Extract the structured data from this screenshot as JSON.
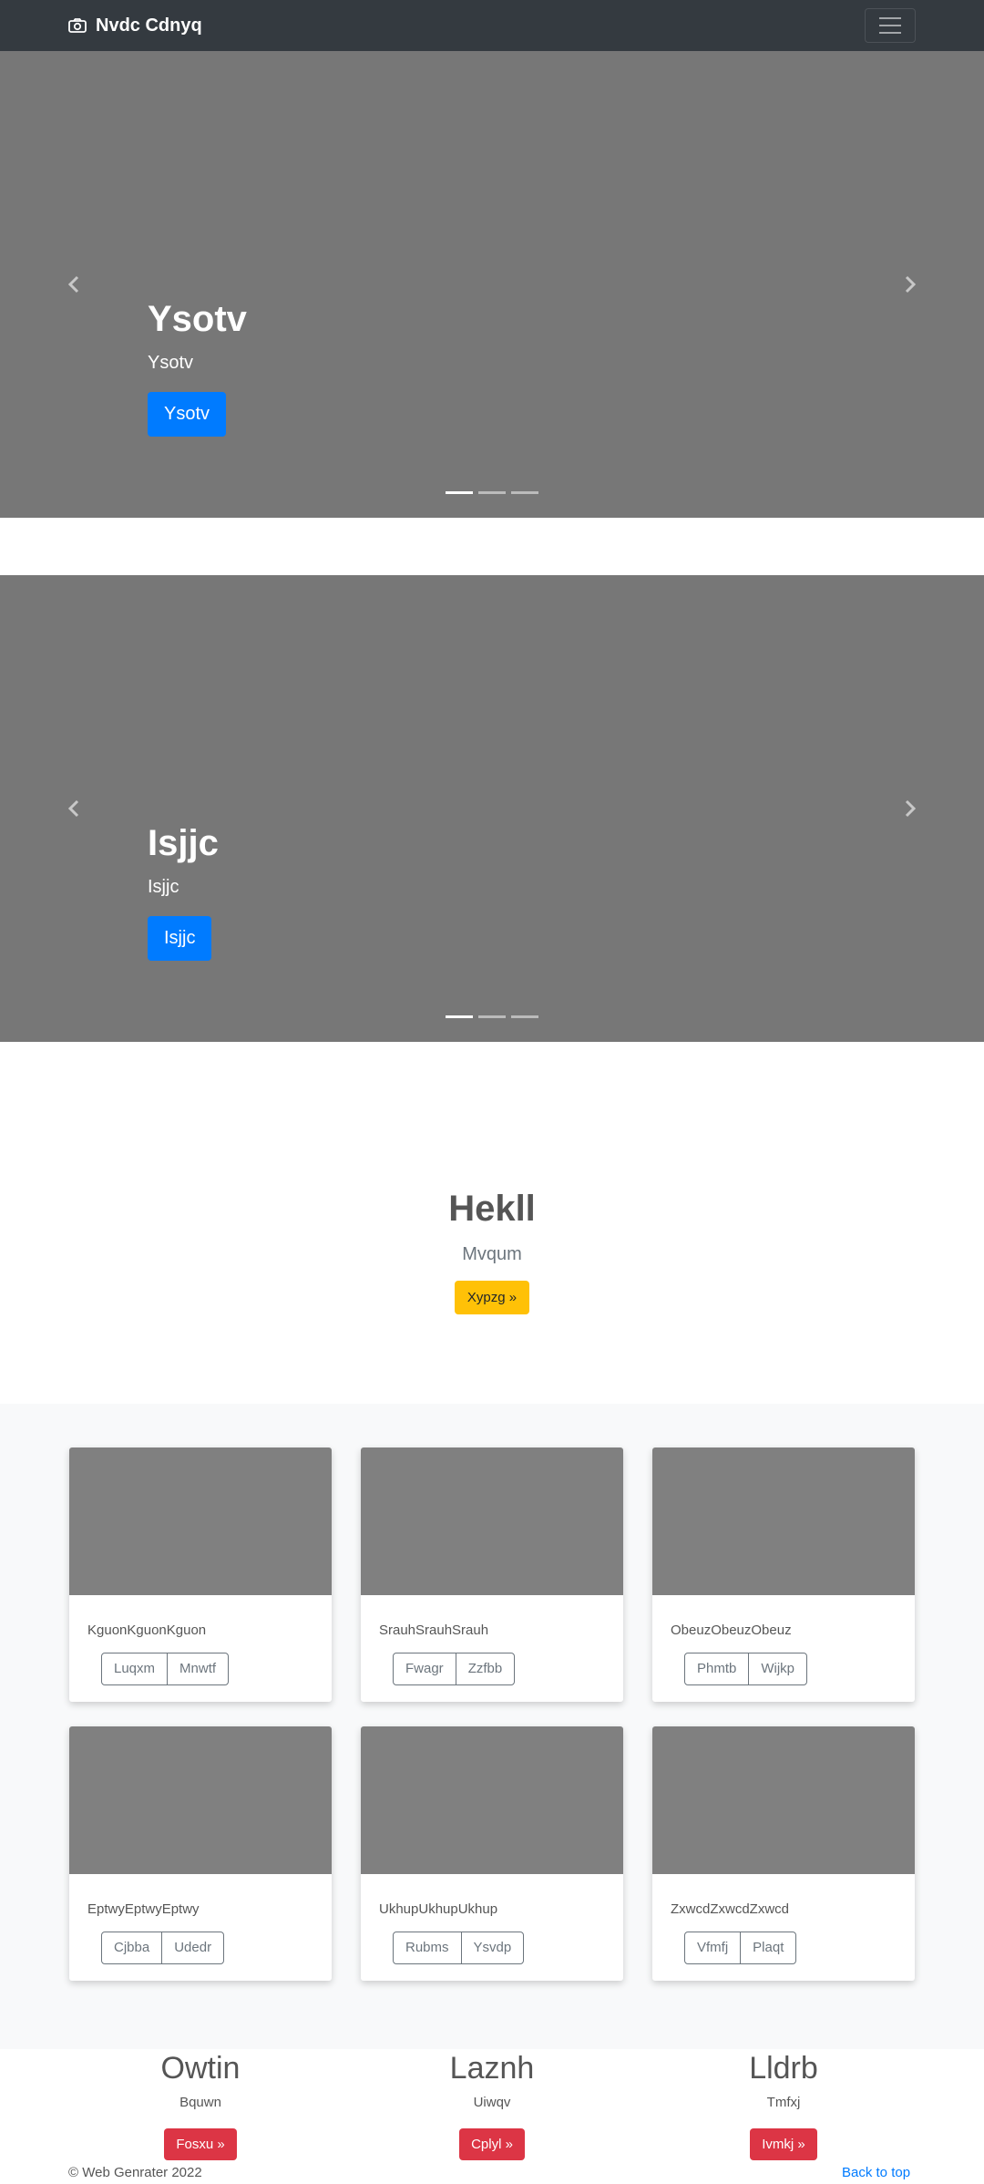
{
  "navbar": {
    "brand": "Nvdc Cdnyq"
  },
  "carousels": [
    {
      "title": "Ysotv",
      "subtitle": "Ysotv",
      "button": "Ysotv"
    },
    {
      "title": "Isjjc",
      "subtitle": "Isjjc",
      "button": "Isjjc"
    }
  ],
  "jumbotron": {
    "heading": "Hekll",
    "lead": "Mvqum",
    "button": "Xypzg »"
  },
  "cards": [
    {
      "text": "KguonKguonKguon",
      "btn1": "Luqxm",
      "btn2": "Mnwtf"
    },
    {
      "text": "SrauhSrauhSrauh",
      "btn1": "Fwagr",
      "btn2": "Zzfbb"
    },
    {
      "text": "ObeuzObeuzObeuz",
      "btn1": "Phmtb",
      "btn2": "Wijkp"
    },
    {
      "text": "EptwyEptwyEptwy",
      "btn1": "Cjbba",
      "btn2": "Udedr"
    },
    {
      "text": "UkhupUkhupUkhup",
      "btn1": "Rubms",
      "btn2": "Ysvdp"
    },
    {
      "text": "ZxwcdZxwcdZxwcd",
      "btn1": "Vfmfj",
      "btn2": "Plaqt"
    }
  ],
  "features": [
    {
      "heading": "Owtin",
      "text": "Bquwn",
      "button": "Fosxu »"
    },
    {
      "heading": "Laznh",
      "text": "Uiwqv",
      "button": "Cplyl »"
    },
    {
      "heading": "Lldrb",
      "text": "Tmfxj",
      "button": "Ivmkj »"
    }
  ],
  "footer": {
    "copyright": "© Web Genrater 2022",
    "back_to_top": "Back to top"
  },
  "colors": {
    "navbar": "#343a40",
    "primary": "#007bff",
    "warning": "#ffc107",
    "danger": "#dc3545"
  },
  "icons": [
    "camera-icon",
    "hamburger-icon",
    "chevron-left-icon",
    "chevron-right-icon"
  ]
}
